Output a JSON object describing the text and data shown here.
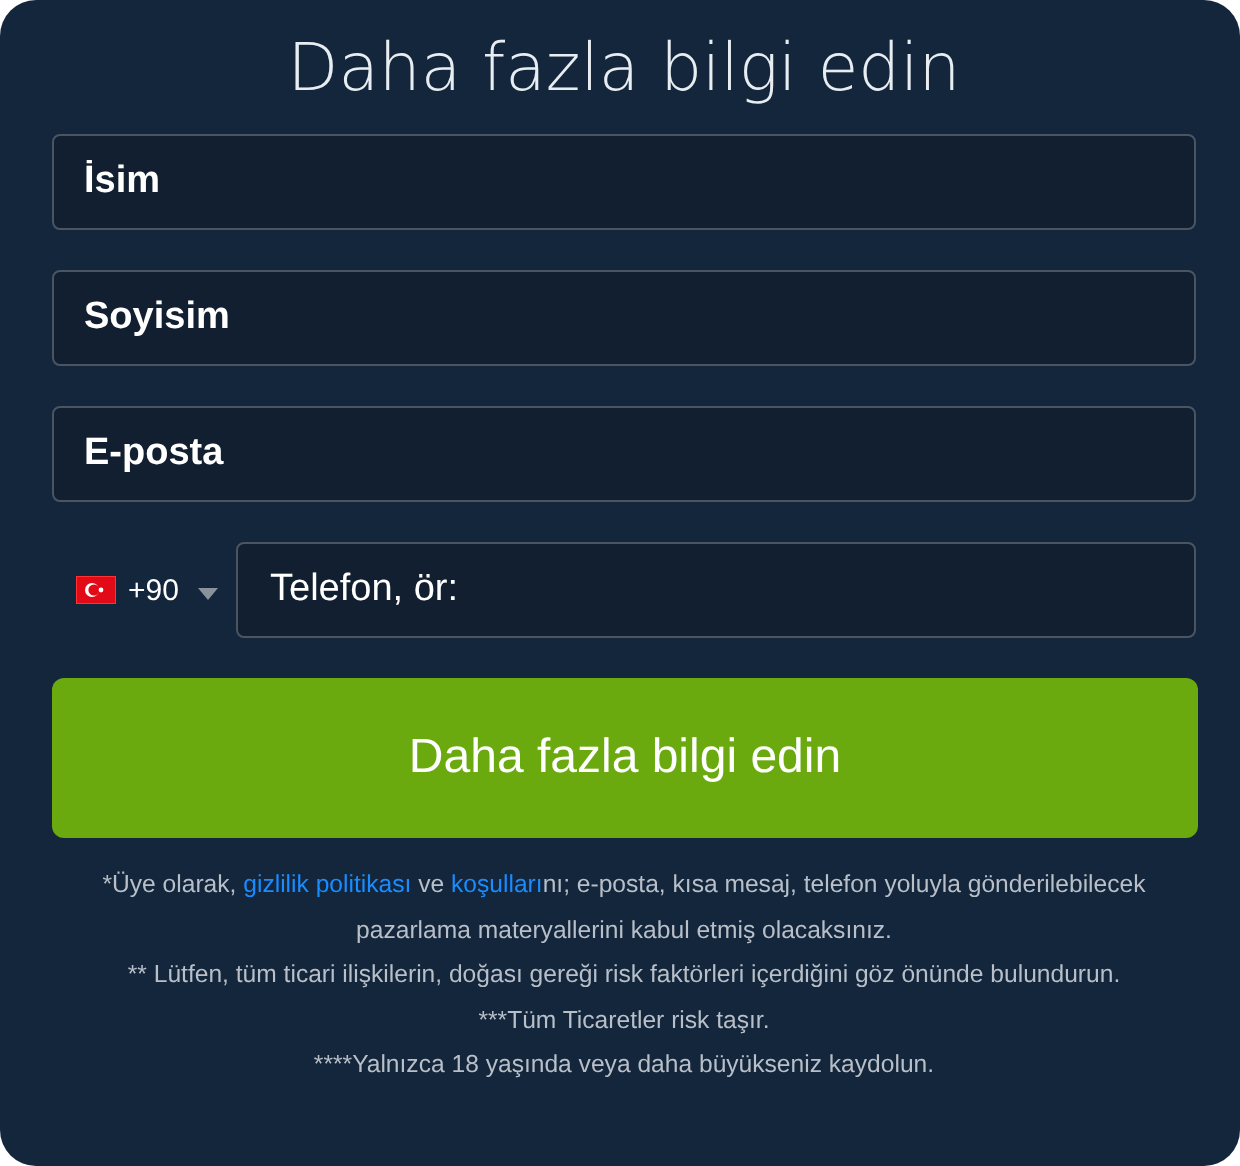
{
  "title": "Daha fazla bilgi edin",
  "fields": [
    {
      "placeholder": "İsim"
    },
    {
      "placeholder": "Soyisim"
    },
    {
      "placeholder": "E-posta"
    }
  ],
  "phone": {
    "country_code": "+90",
    "placeholder": "Telefon, ör:"
  },
  "submit_button": "Daha fazla bilgi edin",
  "disclaimer": [
    {
      "parts": [
        {
          "kind": "text",
          "text": "*Üye olarak, "
        },
        {
          "kind": "link",
          "text": "gizlilik politikası"
        },
        {
          "kind": "text",
          "text": " ve "
        },
        {
          "kind": "link",
          "text": "koşulları"
        },
        {
          "kind": "text",
          "text": "nı; e-posta, kısa mesaj, telefon yoluyla gönderilebilecek pazarlama materyallerini kabul etmiş olacaksınız."
        }
      ]
    },
    {
      "parts": [
        {
          "kind": "text",
          "text": "** Lütfen, tüm ticari ilişkilerin, doğası gereği risk faktörleri içerdiğini göz önünde bulundurun."
        }
      ]
    },
    {
      "parts": [
        {
          "kind": "text",
          "text": "***Tüm Ticaretler risk taşır."
        }
      ]
    },
    {
      "parts": [
        {
          "kind": "text",
          "text": "****Yalnızca 18 yaşında veya daha büyükseniz kaydolun."
        }
      ]
    }
  ]
}
